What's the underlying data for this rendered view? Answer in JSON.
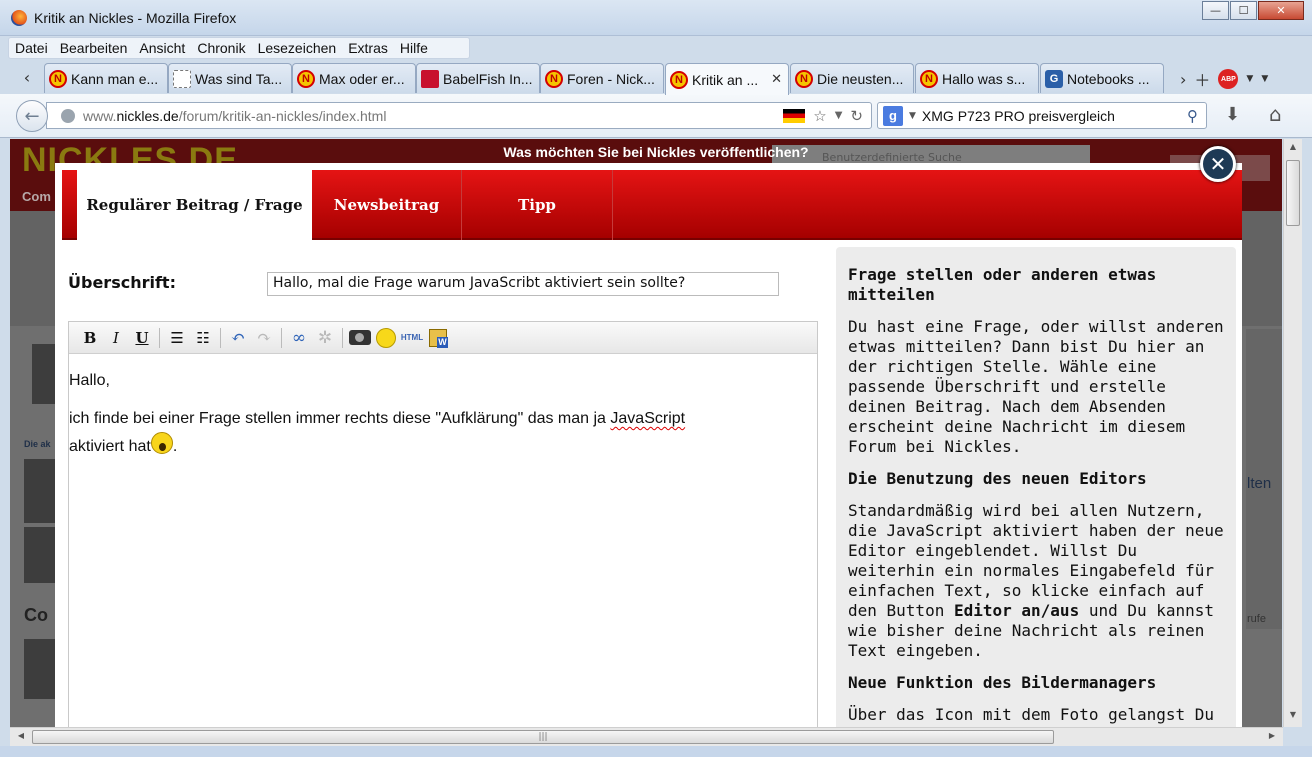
{
  "window": {
    "title": "Kritik an Nickles - Mozilla Firefox",
    "controls": {
      "minimize": "—",
      "maximize": "☐",
      "close": "✕"
    }
  },
  "menubar": [
    "Datei",
    "Bearbeiten",
    "Ansicht",
    "Chronik",
    "Lesezeichen",
    "Extras",
    "Hilfe"
  ],
  "tabs": [
    {
      "label": "Kann man e...",
      "favicon": "nickles-icon",
      "active": false
    },
    {
      "label": "Was sind Ta...",
      "favicon": "blank-page-icon",
      "active": false
    },
    {
      "label": "Max oder er...",
      "favicon": "nickles-icon",
      "active": false
    },
    {
      "label": "BabelFish In...",
      "favicon": "babelfish-icon",
      "active": false
    },
    {
      "label": "Foren - Nick...",
      "favicon": "nickles-icon",
      "active": false
    },
    {
      "label": "Kritik an ...",
      "favicon": "nickles-icon",
      "active": true
    },
    {
      "label": "Die neusten...",
      "favicon": "nickles-icon",
      "active": false
    },
    {
      "label": "Hallo was s...",
      "favicon": "nickles-icon",
      "active": false
    },
    {
      "label": "Notebooks ...",
      "favicon": "geizhals-icon",
      "active": false
    }
  ],
  "tab_icon_text": {
    "nickles": "N",
    "geizhals": "G",
    "abp": "ABP"
  },
  "navbar": {
    "url_prefix": "www.",
    "url_domain": "nickles.de",
    "url_path": "/forum/kritik-an-nickles/index.html",
    "search_value": "XMG P723 PRO preisvergleich",
    "search_engine": "g"
  },
  "background_page": {
    "logo": "NICKLES.DE",
    "logo_sub": "Com",
    "search_placeholder": "Benutzerdefinierte Suche",
    "side_label_1": "Die ak",
    "side_label_2": "Co",
    "side_right_1": "lten",
    "side_right_2": "rufe"
  },
  "modal": {
    "header": "Was möchten Sie bei Nickles veröffentlichen?",
    "close": "✕",
    "tabs": [
      {
        "label": "Regulärer Beitrag / Frage",
        "active": true
      },
      {
        "label": "Newsbeitrag",
        "active": false
      },
      {
        "label": "Tipp",
        "active": false
      }
    ],
    "headline_label": "Überschrift:",
    "headline_value": "Hallo, mal die Frage warum JavaScribt aktiviert sein sollte?",
    "toolbar": {
      "bold": "B",
      "italic": "I",
      "underline": "U",
      "html": "HTML"
    },
    "editor": {
      "line1": "Hallo,",
      "line2_a": "ich finde bei einer Frage stellen immer rechts diese \"Aufklärung\" das man ja ",
      "line2_misspelled": "JavaScript",
      "line3": "aktiviert hat",
      "line3_end": "."
    },
    "sidebar": {
      "h1": "Frage stellen oder anderen etwas mitteilen",
      "p1": "Du hast eine Frage, oder willst anderen etwas mitteilen? Dann bist Du hier an der richtigen Stelle. Wähle eine passende Überschrift und erstelle deinen Beitrag. Nach dem Absenden erscheint deine Nachricht im diesem Forum bei Nickles.",
      "h2": "Die Benutzung des neuen Editors",
      "p2_a": "Standardmäßig wird bei allen Nutzern, die JavaScript aktiviert haben der neue Editor eingeblendet. Willst Du weiterhin ein normales Eingabefeld für einfachen Text, so klicke einfach auf den Button ",
      "p2_bold": "Editor an/aus",
      "p2_b": " und Du kannst wie bisher deine Nachricht als reinen Text eingeben.",
      "h3": "Neue Funktion des Bildermanagers",
      "p3": "Über das Icon mit dem Foto gelangst Du zum Nickles Bildermanager. Du hast hier die Möglichkeit ein Bild in deinen Beitrag"
    }
  },
  "colors": {
    "brand_red": "#cc0000",
    "modal_bg": "#ffffff",
    "sidebar_bg": "#ececec"
  }
}
